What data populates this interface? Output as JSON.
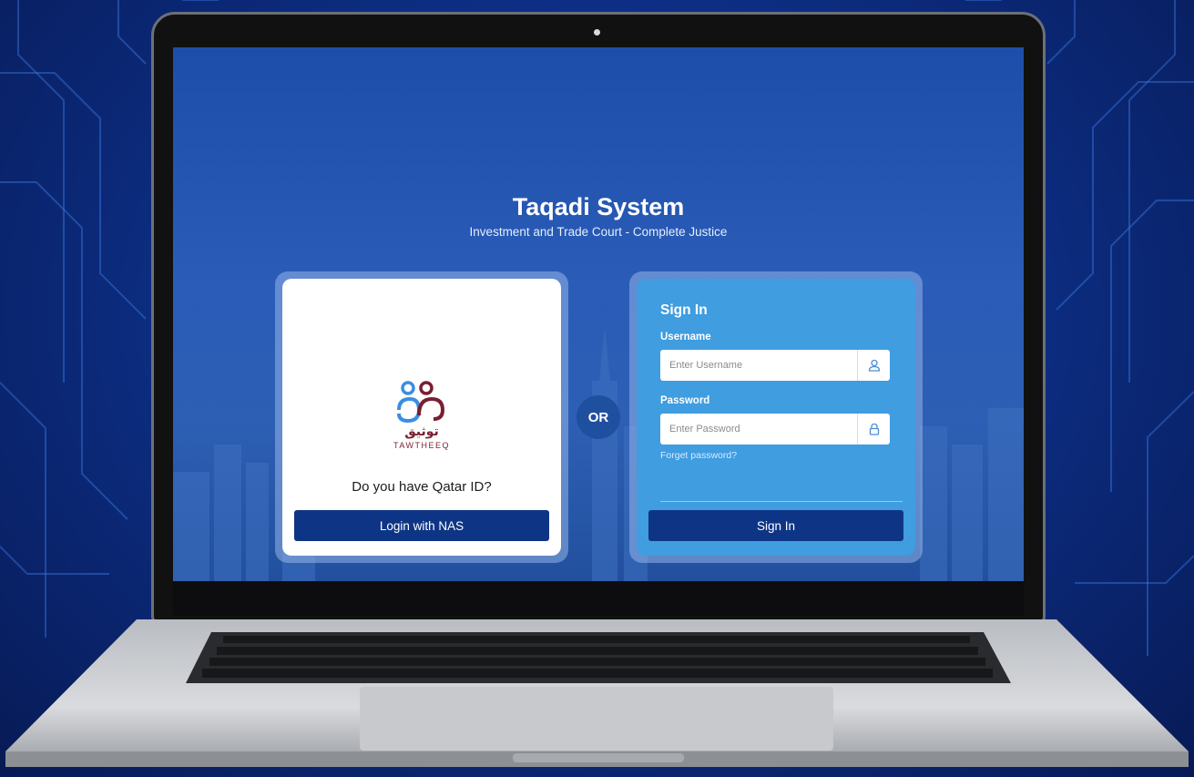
{
  "header": {
    "title": "Taqadi System",
    "subtitle": "Investment and Trade Court - Complete Justice"
  },
  "nas_card": {
    "logo_arabic": "توثيق",
    "logo_text": "TAWTHEEQ",
    "question": "Do you have Qatar ID?",
    "button_label": "Login with NAS"
  },
  "separator": {
    "label": "OR"
  },
  "signin_card": {
    "heading": "Sign In",
    "username": {
      "label": "Username",
      "placeholder": "Enter Username",
      "value": ""
    },
    "password": {
      "label": "Password",
      "placeholder": "Enter Password",
      "value": ""
    },
    "forgot_link": "Forget password?",
    "button_label": "Sign In"
  },
  "icons": {
    "username_icon": "user-icon",
    "password_icon": "lock-icon"
  },
  "colors": {
    "primary_button": "#0e3585",
    "signin_card": "#3f9de0",
    "logo_maroon": "#7a1e31",
    "logo_blue": "#3a8ee0"
  }
}
